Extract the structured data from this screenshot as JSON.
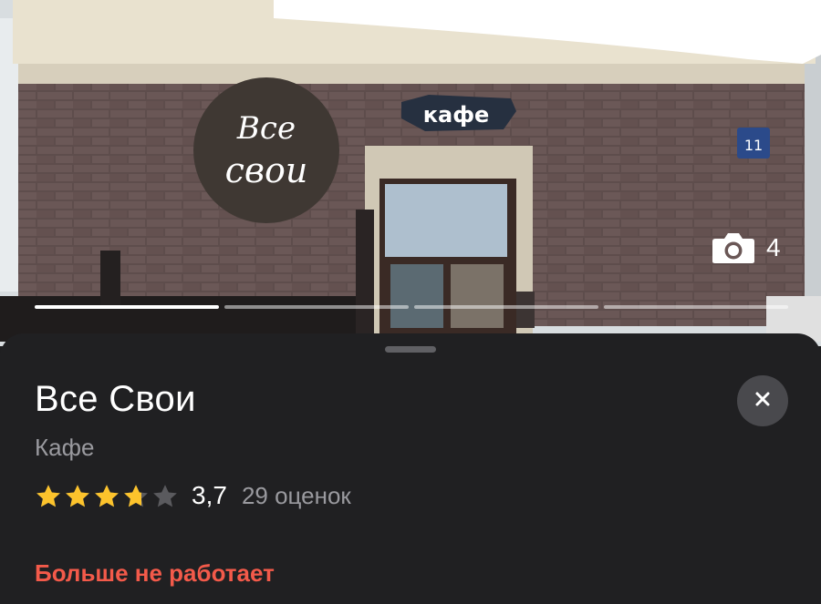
{
  "photo": {
    "logo_line1": "Все",
    "logo_line2": "свои",
    "sign_text": "кафе",
    "house_number": "11",
    "photo_count": "4",
    "progress_segments": 4,
    "active_segment": 1
  },
  "place": {
    "name": "Все Свои",
    "category": "Кафе",
    "rating": 3.7,
    "rating_text": "3,7",
    "reviews_text": "29 оценок",
    "status": "Больше не работает",
    "status_color": "#f35a4a"
  },
  "colors": {
    "sheet_bg": "#202022",
    "star_fill": "#fcc32c",
    "star_empty": "#5a5a5e"
  },
  "icons": {
    "camera": "camera-icon",
    "close": "close-icon",
    "star": "star-icon"
  }
}
